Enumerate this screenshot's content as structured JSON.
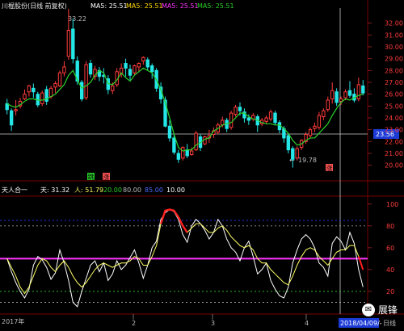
{
  "colors": {
    "up": "#ff3b3b",
    "down": "#24e6e6",
    "ma": "#2bd12b",
    "sky": "#ffffff",
    "human": "#ffff66",
    "magenta": "#ff33ff",
    "grid_blue": "#1f3cff",
    "yellow": "#ffd800"
  },
  "top_header": {
    "title": "川棍股份(日线 前复权)",
    "ma_items": [
      {
        "label": "MA5: 25.51",
        "color": "#ffffff"
      },
      {
        "label": "MA5: 25.51",
        "color": "#ffd800"
      },
      {
        "label": "MA5: 25.51",
        "color": "#ff33ff"
      },
      {
        "label": "MA5: 25.51",
        "color": "#2bd12b"
      }
    ]
  },
  "price_axis": {
    "ticks": [
      "32.00",
      "31.00",
      "30.00",
      "29.00",
      "28.00",
      "27.00",
      "26.00",
      "25.00",
      "24.00",
      "23.00",
      "22.00",
      "21.00",
      "20.00"
    ],
    "current": "23.56"
  },
  "price_annotations": {
    "high": "33.22",
    "low": "19.78",
    "marker_a": "跳",
    "marker_b": "涨",
    "marker_c": "涨",
    "arrow": "←"
  },
  "indicator_header": {
    "name": "天人合一",
    "sky": "天: 31.32",
    "human": "人: 51.79",
    "l20": "20.00",
    "l80": "80.00",
    "l85": "85.00",
    "l10": "10.00"
  },
  "indicator_axis": {
    "ticks": [
      "100",
      "80",
      "60",
      "40",
      "20"
    ]
  },
  "time_axis": {
    "labels": [
      "2017年",
      "2",
      "3",
      "4"
    ],
    "cursor_date": "2018/04/09/-",
    "period": "日线"
  },
  "watermark": {
    "icon": "wechat-icon",
    "text": "展锋"
  },
  "chart_data": [
    {
      "type": "candlestick",
      "title": "川棍股份(日线 前复权)",
      "ylim": [
        19.5,
        33
      ],
      "x": [
        "2017年",
        "2",
        "3",
        "4"
      ],
      "series": [
        {
          "name": "MA5",
          "values": [
            25.2,
            25.0,
            24.9,
            25.1,
            25.4,
            25.6,
            25.6,
            25.5,
            25.5,
            25.6,
            25.8,
            26.0,
            26.4,
            26.8,
            27.6,
            28.0,
            27.2,
            26.5,
            26.7,
            27.0,
            27.6,
            28.0,
            27.8,
            26.9,
            26.8,
            27.2,
            27.8,
            27.4,
            27.1,
            27.6,
            27.9,
            28.2,
            28.0,
            27.8,
            27.2,
            26.4,
            25.3,
            24.0,
            22.6,
            21.5,
            21.2,
            21.3,
            21.3,
            21.7,
            21.9,
            22.2,
            22.3,
            22.9,
            23.1,
            23.4,
            23.5,
            23.6,
            24.0,
            24.4,
            24.4,
            24.1,
            23.9,
            23.8,
            23.6,
            23.5,
            23.5,
            23.4,
            23.4,
            23.1,
            22.7,
            22.1,
            21.7,
            21.8,
            22.1,
            22.3,
            22.3,
            22.7,
            23.1,
            23.5,
            24.2,
            24.8,
            25.3,
            25.6,
            25.5,
            25.7,
            25.9,
            26.0
          ]
        }
      ],
      "candles": [
        [
          25.2,
          25.6,
          24.7,
          24.3
        ],
        [
          24.6,
          24.8,
          23.4,
          22.9
        ],
        [
          24.6,
          25.5,
          24.7,
          24.2
        ],
        [
          25.0,
          25.7,
          25.4,
          24.8
        ],
        [
          25.6,
          26.4,
          26.0,
          25.5
        ],
        [
          26.2,
          26.8,
          26.7,
          25.8
        ],
        [
          26.5,
          26.9,
          26.2,
          25.7
        ],
        [
          26.0,
          26.2,
          25.1,
          24.9
        ],
        [
          25.2,
          26.3,
          26.1,
          25.0
        ],
        [
          26.4,
          26.7,
          25.4,
          25.1
        ],
        [
          25.8,
          26.7,
          26.5,
          25.6
        ],
        [
          26.6,
          27.1,
          26.9,
          26.1
        ],
        [
          26.7,
          28.0,
          27.8,
          26.6
        ],
        [
          27.8,
          28.8,
          28.3,
          27.5
        ],
        [
          29.2,
          33.2,
          31.4,
          28.9
        ],
        [
          31.5,
          32.4,
          29.0,
          28.6
        ],
        [
          28.8,
          29.2,
          27.1,
          26.8
        ],
        [
          27.0,
          27.2,
          25.6,
          25.4
        ],
        [
          25.7,
          28.8,
          28.5,
          25.5
        ],
        [
          28.6,
          28.9,
          27.7,
          27.4
        ],
        [
          27.5,
          28.4,
          28.1,
          27.2
        ],
        [
          28.0,
          28.3,
          27.5,
          27.1
        ],
        [
          27.6,
          28.2,
          27.5,
          26.9
        ],
        [
          27.3,
          27.6,
          26.4,
          26.0
        ],
        [
          26.3,
          27.0,
          26.7,
          26.0
        ],
        [
          26.8,
          28.2,
          27.9,
          26.6
        ],
        [
          27.7,
          28.6,
          28.2,
          27.4
        ],
        [
          28.6,
          29.0,
          28.2,
          27.5
        ],
        [
          28.1,
          28.5,
          27.6,
          27.2
        ],
        [
          27.8,
          28.5,
          28.4,
          27.6
        ],
        [
          28.3,
          28.7,
          28.6,
          27.9
        ],
        [
          28.8,
          29.2,
          29.1,
          28.5
        ],
        [
          28.9,
          29.1,
          28.3,
          28.0
        ],
        [
          28.4,
          28.6,
          27.9,
          27.3
        ],
        [
          28.0,
          28.2,
          26.5,
          26.2
        ],
        [
          26.6,
          27.0,
          25.6,
          25.2
        ],
        [
          25.5,
          25.8,
          23.3,
          23.2
        ],
        [
          23.3,
          23.8,
          22.3,
          22.0
        ],
        [
          22.3,
          22.6,
          21.1,
          20.9
        ],
        [
          21.0,
          21.3,
          20.5,
          20.2
        ],
        [
          20.6,
          21.6,
          21.5,
          20.4
        ],
        [
          21.3,
          21.8,
          20.8,
          20.6
        ],
        [
          20.9,
          21.5,
          21.2,
          20.8
        ],
        [
          21.3,
          22.9,
          22.7,
          21.2
        ],
        [
          22.4,
          22.6,
          21.5,
          21.2
        ],
        [
          21.8,
          22.5,
          22.4,
          21.7
        ],
        [
          22.3,
          23.0,
          22.5,
          21.9
        ],
        [
          22.6,
          23.2,
          22.9,
          22.3
        ],
        [
          22.8,
          23.6,
          23.4,
          22.6
        ],
        [
          23.4,
          24.1,
          23.8,
          23.2
        ],
        [
          23.8,
          24.0,
          23.1,
          22.8
        ],
        [
          23.2,
          24.6,
          24.4,
          23.0
        ],
        [
          24.3,
          25.1,
          24.9,
          24.1
        ],
        [
          24.9,
          25.3,
          24.6,
          24.2
        ],
        [
          24.5,
          24.8,
          24.0,
          23.6
        ],
        [
          24.0,
          24.3,
          23.8,
          23.4
        ],
        [
          23.9,
          24.4,
          24.2,
          23.7
        ],
        [
          24.1,
          24.3,
          23.4,
          22.8
        ],
        [
          23.5,
          24.0,
          23.8,
          23.3
        ],
        [
          23.7,
          24.2,
          24.0,
          23.5
        ],
        [
          23.9,
          24.7,
          24.5,
          23.7
        ],
        [
          24.4,
          24.6,
          23.6,
          23.4
        ],
        [
          23.6,
          23.8,
          23.0,
          22.7
        ],
        [
          23.1,
          23.3,
          22.3,
          21.9
        ],
        [
          22.5,
          22.7,
          21.3,
          21.0
        ],
        [
          21.4,
          21.6,
          20.5,
          19.8
        ],
        [
          20.6,
          21.6,
          21.4,
          20.4
        ],
        [
          21.5,
          22.2,
          22.1,
          21.3
        ],
        [
          22.0,
          22.8,
          22.6,
          21.8
        ],
        [
          22.5,
          23.2,
          23.0,
          22.3
        ],
        [
          23.1,
          23.6,
          23.3,
          22.8
        ],
        [
          23.2,
          24.5,
          24.2,
          23.0
        ],
        [
          24.1,
          24.8,
          24.6,
          23.8
        ],
        [
          24.7,
          25.8,
          25.5,
          24.5
        ],
        [
          25.6,
          27.0,
          26.3,
          25.2
        ],
        [
          26.2,
          26.5,
          25.3,
          25.0
        ],
        [
          25.4,
          25.8,
          25.6,
          25.1
        ],
        [
          25.7,
          26.4,
          26.2,
          25.5
        ],
        [
          26.3,
          27.1,
          25.9,
          25.7
        ],
        [
          26.0,
          26.5,
          25.5,
          25.3
        ],
        [
          25.6,
          27.4,
          26.8,
          25.4
        ],
        [
          26.7,
          27.2,
          26.1,
          25.9
        ]
      ]
    },
    {
      "type": "line",
      "title": "天人合一",
      "ylim": [
        0,
        105
      ],
      "reference_lines": [
        20,
        50,
        80,
        85,
        10
      ],
      "series": [
        {
          "name": "天",
          "values": [
            50,
            38,
            28,
            20,
            14,
            22,
            44,
            52,
            49,
            42,
            31,
            37,
            58,
            46,
            30,
            10,
            6,
            20,
            32,
            44,
            48,
            38,
            46,
            30,
            36,
            48,
            40,
            44,
            51,
            58,
            46,
            32,
            44,
            60,
            66,
            86,
            92,
            95,
            93,
            86,
            72,
            65,
            80,
            86,
            82,
            76,
            68,
            74,
            86,
            80,
            68,
            60,
            56,
            48,
            60,
            66,
            52,
            36,
            40,
            46,
            30,
            22,
            16,
            14,
            24,
            46,
            58,
            68,
            72,
            68,
            60,
            46,
            42,
            34,
            64,
            70,
            66,
            58,
            74,
            64,
            40,
            24
          ]
        },
        {
          "name": "人",
          "values": [
            50,
            42,
            34,
            24,
            18,
            24,
            34,
            44,
            50,
            48,
            42,
            38,
            44,
            48,
            42,
            34,
            28,
            24,
            28,
            34,
            40,
            44,
            46,
            44,
            42,
            44,
            46,
            46,
            48,
            52,
            50,
            44,
            44,
            52,
            62,
            82,
            94,
            95,
            94,
            88,
            80,
            74,
            78,
            82,
            82,
            78,
            74,
            74,
            78,
            80,
            76,
            70,
            66,
            62,
            60,
            62,
            58,
            50,
            46,
            46,
            40,
            36,
            32,
            28,
            26,
            34,
            44,
            52,
            58,
            60,
            58,
            52,
            48,
            44,
            50,
            56,
            58,
            58,
            62,
            62,
            52,
            40
          ]
        }
      ]
    }
  ]
}
